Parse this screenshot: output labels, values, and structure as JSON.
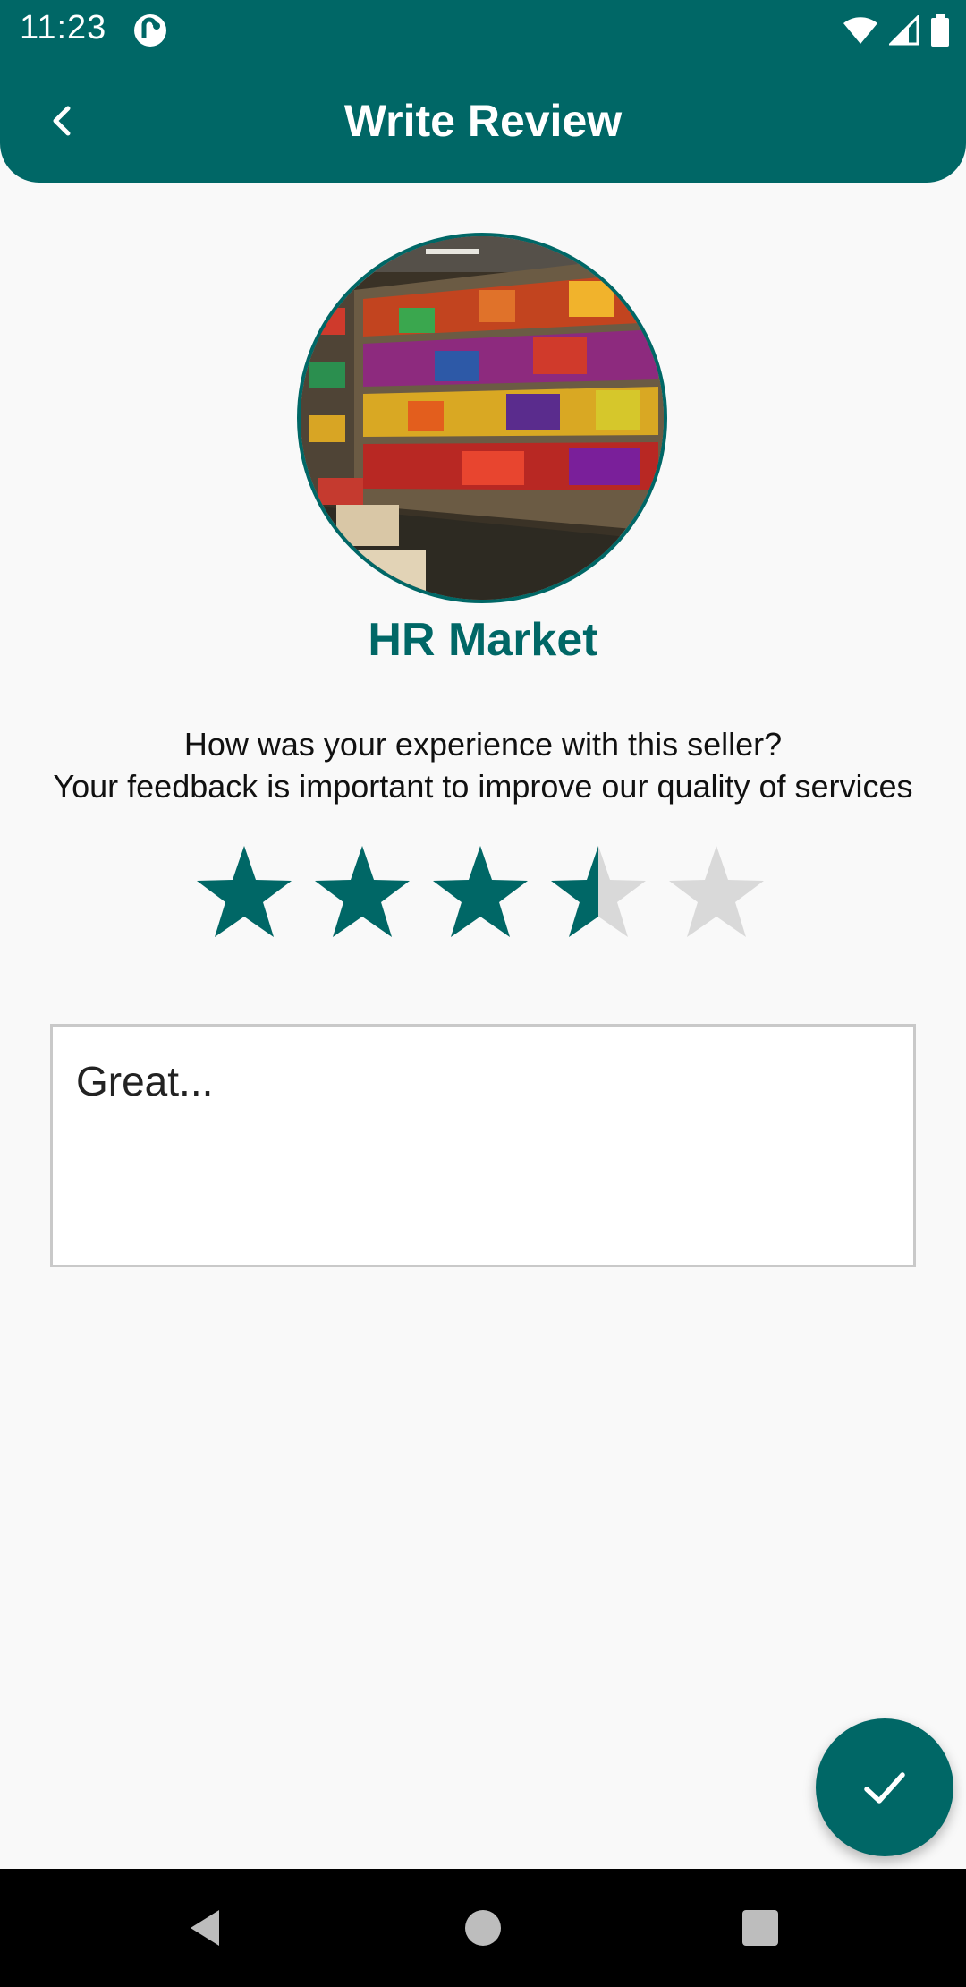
{
  "status_bar": {
    "time": "11:23",
    "icons": [
      "app-notification-icon",
      "wifi-icon",
      "signal-icon",
      "battery-icon"
    ]
  },
  "header": {
    "title": "Write Review",
    "back_icon": "chevron-left-icon",
    "background_color": "#006766"
  },
  "seller": {
    "name": "HR Market",
    "avatar_description_icon": "store-photo"
  },
  "prompt": {
    "line1": "How was your experience with this seller?",
    "line2": "Your feedback is important to improve our quality of services"
  },
  "rating": {
    "value": 3.5,
    "max": 5,
    "filled_color": "#006766",
    "empty_color": "#d9d9d9"
  },
  "review": {
    "value": "Great..."
  },
  "fab": {
    "icon": "check-icon"
  },
  "nav_bar": {
    "icons": [
      "back-triangle-icon",
      "home-circle-icon",
      "recents-square-icon"
    ]
  }
}
